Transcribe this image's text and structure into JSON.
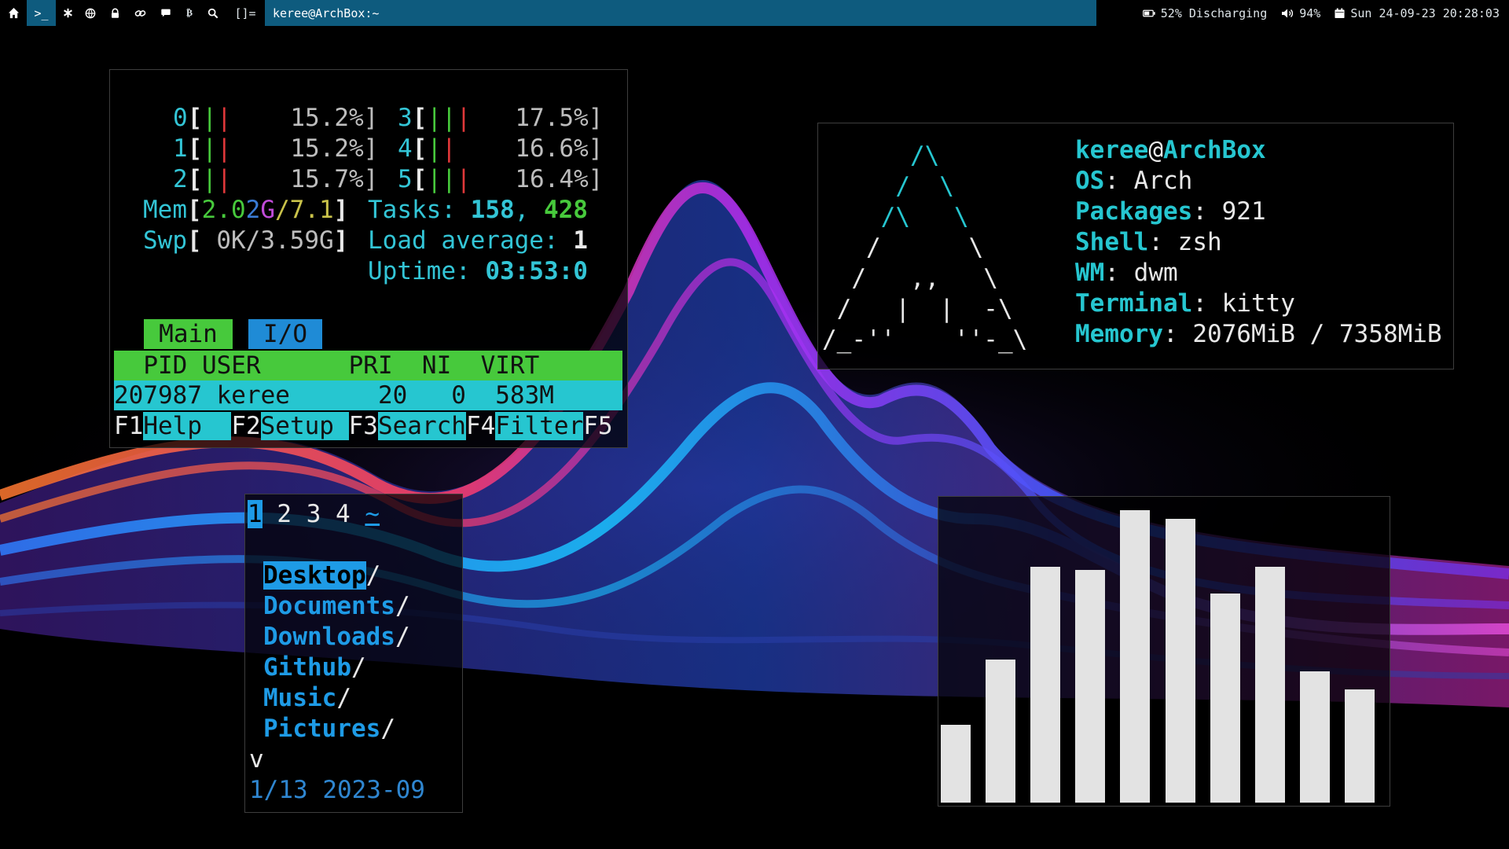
{
  "topbar": {
    "terminal_tag": ">_",
    "layout": "[]=",
    "window_title": "keree@ArchBox:~",
    "battery": "52% Discharging",
    "volume": "94%",
    "datetime": "Sun 24-09-23 20:28:03",
    "icons": [
      "home-icon",
      "terminal-icon",
      "asterisk-icon",
      "globe-icon",
      "lock-icon",
      "link-icon",
      "chat-icon",
      "bitcoin-icon",
      "search-icon",
      "battery-icon",
      "volume-icon",
      "calendar-icon"
    ]
  },
  "htop": {
    "cpus": [
      {
        "id": "0",
        "pct": "15.2%]"
      },
      {
        "id": "1",
        "pct": "15.2%]"
      },
      {
        "id": "2",
        "pct": "15.7%]"
      },
      {
        "id": "3",
        "pct": "17.5%]"
      },
      {
        "id": "4",
        "pct": "16.6%]"
      },
      {
        "id": "5",
        "pct": "16.4%]"
      }
    ],
    "mem_label": "Mem",
    "mem_value": "2.02G",
    "mem_total": "/7.1",
    "swp_label": "Swp",
    "swp_value": " 0K/3.59G",
    "tasks_label": "Tasks: ",
    "tasks_value": "158",
    "tasks_sep": ", ",
    "threads_value": "428",
    "load_label": "Load average: ",
    "load_value": "1",
    "uptime_label": "Uptime: ",
    "uptime_value": "03:53:0",
    "tab_main": "Main",
    "tab_io": "I/O",
    "header": "  PID USER      PRI  NI  VIRT",
    "process": "207987 keree      20   0  583M",
    "fkeys": [
      {
        "key": "F1",
        "label": "Help  "
      },
      {
        "key": "F2",
        "label": "Setup "
      },
      {
        "key": "F3",
        "label": "Search"
      },
      {
        "key": "F4",
        "label": "Filter"
      },
      {
        "key": "F5",
        "label": ""
      }
    ]
  },
  "fetch": {
    "logo": [
      "      /\\",
      "     /  \\",
      "    /\\   \\",
      "   /      \\",
      "  /   ,,   \\",
      " /   |  |  -\\",
      "/_-''    ''-_\\"
    ],
    "user": "keree",
    "at": "@",
    "host": "ArchBox",
    "os_label": "OS",
    "os_value": "Arch",
    "packages_label": "Packages",
    "packages_value": "921",
    "shell_label": "Shell",
    "shell_value": "zsh",
    "wm_label": "WM",
    "wm_value": "dwm",
    "terminal_label": "Terminal",
    "terminal_value": "kitty",
    "memory_label": "Memory",
    "memory_value": "2076MiB / 7358MiB"
  },
  "lf": {
    "tabs": [
      "1",
      "2",
      "3",
      "4",
      "~"
    ],
    "entries": [
      "Desktop",
      "Documents",
      "Downloads",
      "Github",
      "Music",
      "Pictures"
    ],
    "more": "v",
    "status": "1/13 2023-09"
  },
  "cava": {
    "levels": [
      0.26,
      0.48,
      0.79,
      0.78,
      0.98,
      0.95,
      0.7,
      0.79,
      0.44,
      0.38
    ]
  }
}
